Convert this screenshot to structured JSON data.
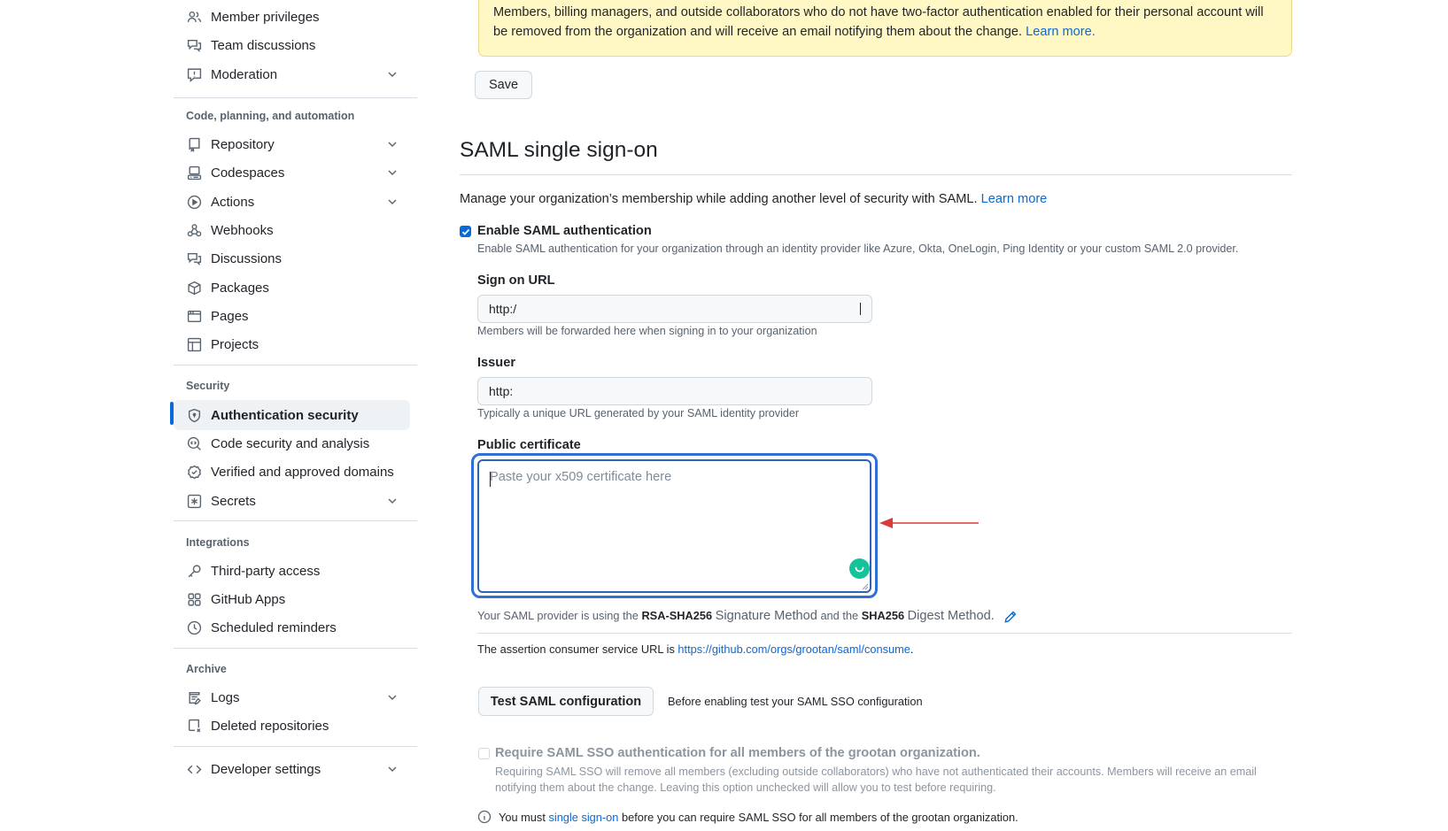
{
  "sidebar": {
    "items_top": [
      {
        "label": "Member privileges",
        "icon": "people-icon"
      },
      {
        "label": "Team discussions",
        "icon": "comment-discussion-icon"
      },
      {
        "label": "Moderation",
        "icon": "report-icon",
        "expandable": true
      }
    ],
    "sections": [
      {
        "heading": "Code, planning, and automation",
        "items": [
          {
            "label": "Repository",
            "icon": "repo-icon",
            "expandable": true
          },
          {
            "label": "Codespaces",
            "icon": "codespaces-icon",
            "expandable": true
          },
          {
            "label": "Actions",
            "icon": "play-icon",
            "expandable": true
          },
          {
            "label": "Webhooks",
            "icon": "webhook-icon"
          },
          {
            "label": "Discussions",
            "icon": "comment-discussion-icon"
          },
          {
            "label": "Packages",
            "icon": "package-icon"
          },
          {
            "label": "Pages",
            "icon": "browser-icon"
          },
          {
            "label": "Projects",
            "icon": "table-icon"
          }
        ]
      },
      {
        "heading": "Security",
        "items": [
          {
            "label": "Authentication security",
            "icon": "shield-lock-icon",
            "active": true
          },
          {
            "label": "Code security and analysis",
            "icon": "codescan-icon"
          },
          {
            "label": "Verified and approved domains",
            "icon": "verified-icon"
          },
          {
            "label": "Secrets",
            "icon": "key-asterisk-icon",
            "expandable": true
          }
        ]
      },
      {
        "heading": "Integrations",
        "items": [
          {
            "label": "Third-party access",
            "icon": "key-icon"
          },
          {
            "label": "GitHub Apps",
            "icon": "apps-icon"
          },
          {
            "label": "Scheduled reminders",
            "icon": "clock-icon"
          }
        ]
      },
      {
        "heading": "Archive",
        "items": [
          {
            "label": "Logs",
            "icon": "log-icon",
            "expandable": true
          },
          {
            "label": "Deleted repositories",
            "icon": "repo-deleted-icon"
          }
        ]
      }
    ],
    "developer_settings": {
      "label": "Developer settings",
      "icon": "code-icon",
      "expandable": true
    }
  },
  "two_factor": {
    "warning_text": "Members, billing managers, and outside collaborators who do not have two-factor authentication enabled for their personal account will be removed from the organization and will receive an email notifying them about the change.",
    "warning_link": "Learn more.",
    "save_label": "Save"
  },
  "saml": {
    "title": "SAML single sign-on",
    "intro_text": "Manage your organization’s membership while adding another level of security with SAML.",
    "intro_link": "Learn more",
    "enable": {
      "label": "Enable SAML authentication",
      "checked": true,
      "description": "Enable SAML authentication for your organization through an identity provider like Azure, Okta, OneLogin, Ping Identity or your custom SAML 2.0 provider."
    },
    "sign_on_url": {
      "label": "Sign on URL",
      "value": "http:/",
      "hint": "Members will be forwarded here when signing in to your organization"
    },
    "issuer": {
      "label": "Issuer",
      "value": "http:",
      "hint": "Typically a unique URL generated by your SAML identity provider"
    },
    "certificate": {
      "label": "Public certificate",
      "value": "",
      "placeholder": "Paste your x509 certificate here"
    },
    "methods": {
      "prefix": "Your SAML provider is using the",
      "signature_method": "RSA-SHA256",
      "signature_suffix": "Signature Method",
      "middle": "and the",
      "digest_method": "SHA256",
      "digest_suffix": "Digest Method."
    },
    "acs": {
      "prefix": "The assertion consumer service URL is",
      "url": "https://github.com/orgs/grootan/saml/consume",
      "suffix": "."
    },
    "test_button_label": "Test SAML configuration",
    "test_note": "Before enabling test your SAML SSO configuration",
    "require": {
      "label": "Require SAML SSO authentication for all members of the grootan organization.",
      "checked": false,
      "description": "Requiring SAML SSO will remove all members (excluding outside collaborators) who have not authenticated their accounts. Members will receive an email notifying them about the change. Leaving this option unchecked will allow you to test before requiring."
    },
    "info": {
      "prefix": "You must",
      "link": "single sign-on",
      "suffix": "before you can require SAML SSO for all members of the grootan organization."
    }
  },
  "annotation": {
    "type": "arrow",
    "color": "#d93a3a",
    "points_to": "public-certificate-textarea"
  },
  "colors": {
    "accent": "#0969da",
    "warning_bg": "#fff8c5",
    "focus_ring": "#2f6fd6",
    "grammarly": "#15c39a"
  }
}
